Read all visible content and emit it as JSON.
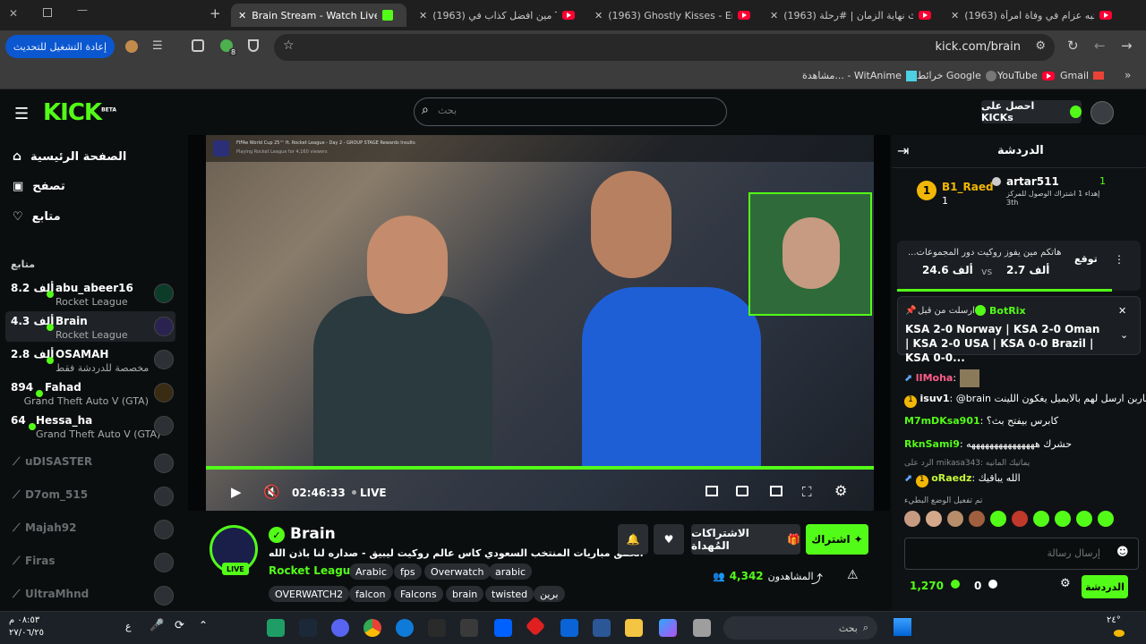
{
  "browser": {
    "tabs": [
      {
        "title": "Brain Stream - Watch Live on Kick",
        "active": true
      },
      {
        "title": "(1963) مين افضل كذاب في Tube",
        "active": false
      },
      {
        "title": "(1963) Ghostly Kisses - Empty N",
        "active": false
      },
      {
        "title": "(1963) احداث نهاية الزمان | #رحلة",
        "active": false
      },
      {
        "title": "(1963) يشتبه عزام في وفاة امرأة",
        "active": false
      }
    ],
    "url": "kick.com/brain",
    "update_button": "إعادة التشغيل للتحديث",
    "extension_badge": "8",
    "bookmarks": [
      "Gmail",
      "YouTube",
      "خرائط Google",
      "مشاهدة... - WitAnime"
    ]
  },
  "header": {
    "logo": "KICK",
    "logo_badge": "BETA",
    "search_placeholder": "بحث",
    "get_kicks_label": "احصل على KICKs"
  },
  "sidebar": {
    "nav": [
      {
        "label": "الصفحة الرئيسية"
      },
      {
        "label": "تصفح"
      },
      {
        "label": "متابع"
      }
    ],
    "following_title": "متابع",
    "live_channels": [
      {
        "name": "abu_abeer16",
        "game": "Rocket League",
        "viewers": "8.2 ألف"
      },
      {
        "name": "Brain",
        "game": "Rocket League",
        "viewers": "4.3 ألف"
      },
      {
        "name": "OSAMAH",
        "game": "مخصصة للدردشة فقط",
        "viewers": "2.8 ألف"
      },
      {
        "name": "Fahad",
        "game": "Grand Theft Auto V (GTA)",
        "viewers": "894"
      },
      {
        "name": "Hessa_ha",
        "game": "Grand Theft Auto V (GTA)",
        "viewers": "64"
      }
    ],
    "offline_channels": [
      "uDISASTER",
      "D7om_515",
      "Majah92",
      "Firas",
      "UltraMhnd"
    ]
  },
  "player": {
    "overlay_title": "FIFAe World Cup 25™ ft. Rocket League - Day 2 - GROUP STAGE Rewards Insults",
    "overlay_sub": "Playing Rocket League for 4,160 viewers",
    "time": "02:46:33",
    "live_label": "LIVE"
  },
  "stream": {
    "name": "Brain",
    "title": "الحمق مباريات المنتخب السعودي كاس عالم روكيت ليبيق - صداره لنا باذن الله",
    "category": "Rocket League",
    "tags": [
      "Arabic",
      "fps",
      "Overwatch",
      "arabic",
      "OVERWATCH2",
      "falcon",
      "Falcons",
      "brain",
      "twisted",
      "برين"
    ],
    "live_badge": "LIVE",
    "viewers_label": "المشاهدون",
    "viewers": "4,342",
    "subscribe": "اشتراك",
    "gift_subs": "الاشتراكات المُهداة"
  },
  "chat": {
    "title": "الدردشة",
    "leader_left": {
      "name": "B1_Raed",
      "count": "1"
    },
    "leader_right": {
      "name": "artar511",
      "count": "1",
      "sub": "إهداء 1 اشتراك الوصول للمركز 3th"
    },
    "prediction": {
      "question": "...هاتكم مين يفوز روكيت دور المجموعات",
      "left_value": "2.7 ألف",
      "vs": "vs",
      "right_value": "24.6 ألف",
      "button": "توقع"
    },
    "pinned": {
      "pinned_by": "ارسلت من قبل",
      "bot": "BotRix",
      "text": "KSA 2-0 Norway | KSA 2-0 Oman | KSA 2-0 USA | KSA 0-0 Brazil | KSA 0-0..."
    },
    "messages": [
      {
        "user": "lIMoha",
        "text": "",
        "color": "#ff5c8a"
      },
      {
        "user": "isuv1",
        "text": "@brain باربن ارسل لهم بالايميل يغكون اللينت",
        "color": "#ffffff"
      },
      {
        "user": "M7mDKsa901",
        "text": "كابرس بيفتح بث؟",
        "color": "#53fc18"
      },
      {
        "user": "RknSami9",
        "text": "حشرك هههههههههههههههه",
        "color": "#53fc18"
      },
      {
        "user": "oRaedz",
        "text": "الله يباقيك",
        "color": "#c3f73a",
        "reply": "الرد على mikasa343: يماتيك المانيه"
      }
    ],
    "reward_note": "تم تفعيل الوضع البطيء",
    "input_placeholder": "إرسال رسالة",
    "points": "1,270",
    "zero": "0",
    "chat_button": "الدردشة"
  },
  "taskbar": {
    "search": "بحث",
    "time": "٠٨:٥٣ م",
    "date": "٢٧/٠٦/٢٥",
    "lang": "ع",
    "battery": "٢٤°"
  }
}
